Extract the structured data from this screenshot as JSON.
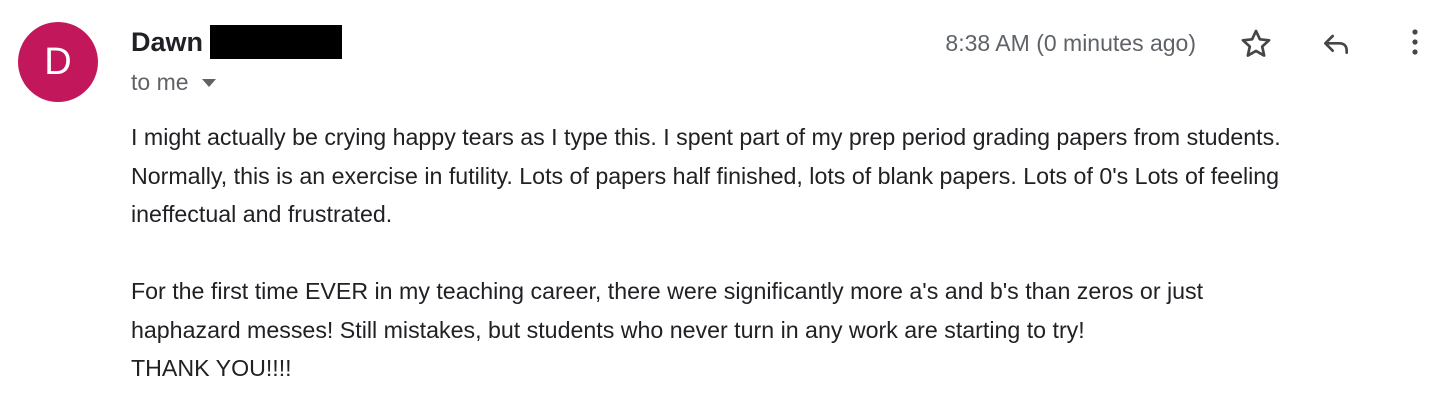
{
  "message": {
    "sender_initial": "D",
    "sender_name": "Dawn",
    "recipient_label": "to me",
    "timestamp": "8:38 AM (0 minutes ago)",
    "body": {
      "paragraph_1": "I might actually be crying happy tears as I type this. I spent part of my prep period grading papers from students.\nNormally, this is an exercise in futility. Lots of papers half finished, lots of blank papers. Lots of 0's Lots of feeling\nineffectual and frustrated.",
      "paragraph_2": "For the first time EVER in my teaching career, there were significantly more a's and b's than zeros or just\nhaphazard messes! Still mistakes, but students who never turn in any work are starting to try!",
      "closing": "THANK YOU!!!!"
    }
  },
  "icons": {
    "star": "star-icon",
    "reply": "reply-icon",
    "more": "more-vert-icon",
    "recipient_dropdown": "caret-down-icon"
  },
  "colors": {
    "avatar_background": "#c2185b",
    "primary_text": "#202124",
    "secondary_text": "#5f6368"
  }
}
